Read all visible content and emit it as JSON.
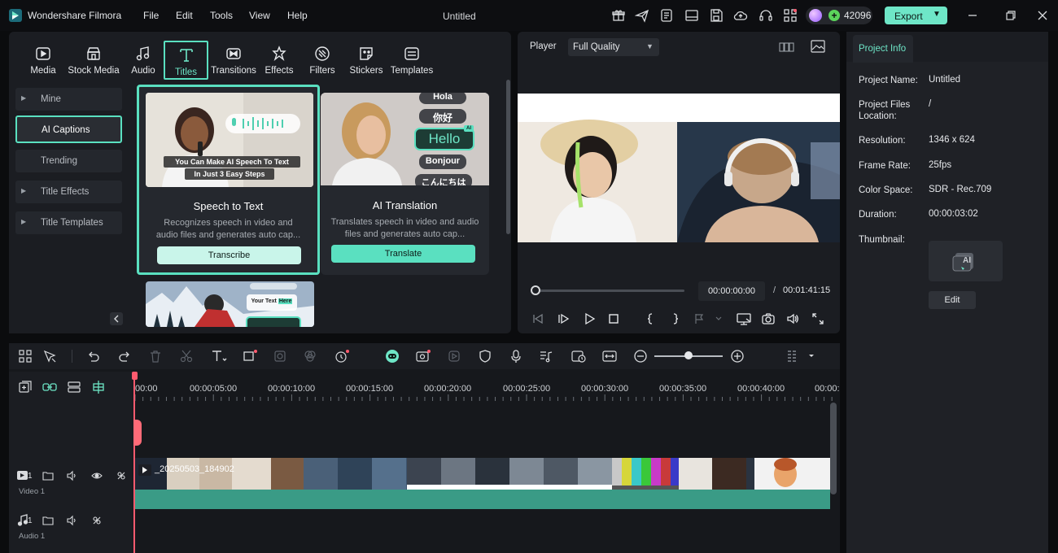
{
  "app": {
    "name": "Wondershare Filmora",
    "document_title": "Untitled",
    "menu": [
      "File",
      "Edit",
      "Tools",
      "View",
      "Help"
    ],
    "credits": "42096",
    "export_label": "Export"
  },
  "library": {
    "tabs": [
      {
        "label": "Media",
        "icon": "media-icon"
      },
      {
        "label": "Stock Media",
        "icon": "stock-media-icon"
      },
      {
        "label": "Audio",
        "icon": "audio-icon"
      },
      {
        "label": "Titles",
        "icon": "titles-icon",
        "selected": true
      },
      {
        "label": "Transitions",
        "icon": "transitions-icon"
      },
      {
        "label": "Effects",
        "icon": "effects-icon"
      },
      {
        "label": "Filters",
        "icon": "filters-icon"
      },
      {
        "label": "Stickers",
        "icon": "stickers-icon"
      },
      {
        "label": "Templates",
        "icon": "templates-icon"
      }
    ],
    "sidebar": [
      {
        "label": "Mine",
        "arrow": true
      },
      {
        "label": "AI Captions",
        "selected": true
      },
      {
        "label": "Trending"
      },
      {
        "label": "Title Effects",
        "arrow": true
      },
      {
        "label": "Title Templates",
        "arrow": true
      }
    ],
    "cards": [
      {
        "title": "Speech to Text",
        "desc_line1": "Recognizes speech in video and",
        "desc_line2": "audio files and generates auto cap...",
        "button": "Transcribe",
        "thumb_line1": "You Can Make AI Speech To Text",
        "thumb_line2": "In Just  3 Easy Steps"
      },
      {
        "title": "AI Translation",
        "desc_line1": "Translates speech in video and audio",
        "desc_line2": "files and generates auto cap...",
        "button": "Translate",
        "thumb_words": [
          "Hola",
          "你好",
          "Hello",
          "Bonjour",
          "こんにちは"
        ],
        "thumb_badge": "AI"
      },
      {
        "thumb_text_a": "Your Text ",
        "thumb_text_b": "Here"
      }
    ]
  },
  "player": {
    "label": "Player",
    "quality": "Full Quality",
    "time_current": "00:00:00:00",
    "time_separator": "/",
    "time_total": "00:01:41:15"
  },
  "project_info": {
    "tab": "Project Info",
    "fields": [
      {
        "key": "Project Name:",
        "value": "Untitled"
      },
      {
        "key": "Project Files Location:",
        "value": "/"
      },
      {
        "key": "Resolution:",
        "value": "1346 x 624"
      },
      {
        "key": "Frame Rate:",
        "value": "25fps"
      },
      {
        "key": "Color Space:",
        "value": "SDR - Rec.709"
      },
      {
        "key": "Duration:",
        "value": "00:00:03:02"
      }
    ],
    "thumbnail_label": "Thumbnail:",
    "thumbnail_badge": "AI",
    "edit_label": "Edit"
  },
  "timeline": {
    "ruler": [
      "00:00",
      "00:00:05:00",
      "00:00:10:00",
      "00:00:15:00",
      "00:00:20:00",
      "00:00:25:00",
      "00:00:30:00",
      "00:00:35:00",
      "00:00:40:00",
      "00:00:"
    ],
    "zoom_level": 0.5,
    "clip_name": "_20250503_184902",
    "tracks": [
      {
        "number": "1",
        "name": "Video 1"
      },
      {
        "number": "1",
        "name": "Audio 1"
      }
    ]
  },
  "colors": {
    "accent": "#6ee6c7",
    "highlight": "#5ae0c0",
    "playhead": "#ff5a6e",
    "audio_waveform": "#3a9b86"
  }
}
